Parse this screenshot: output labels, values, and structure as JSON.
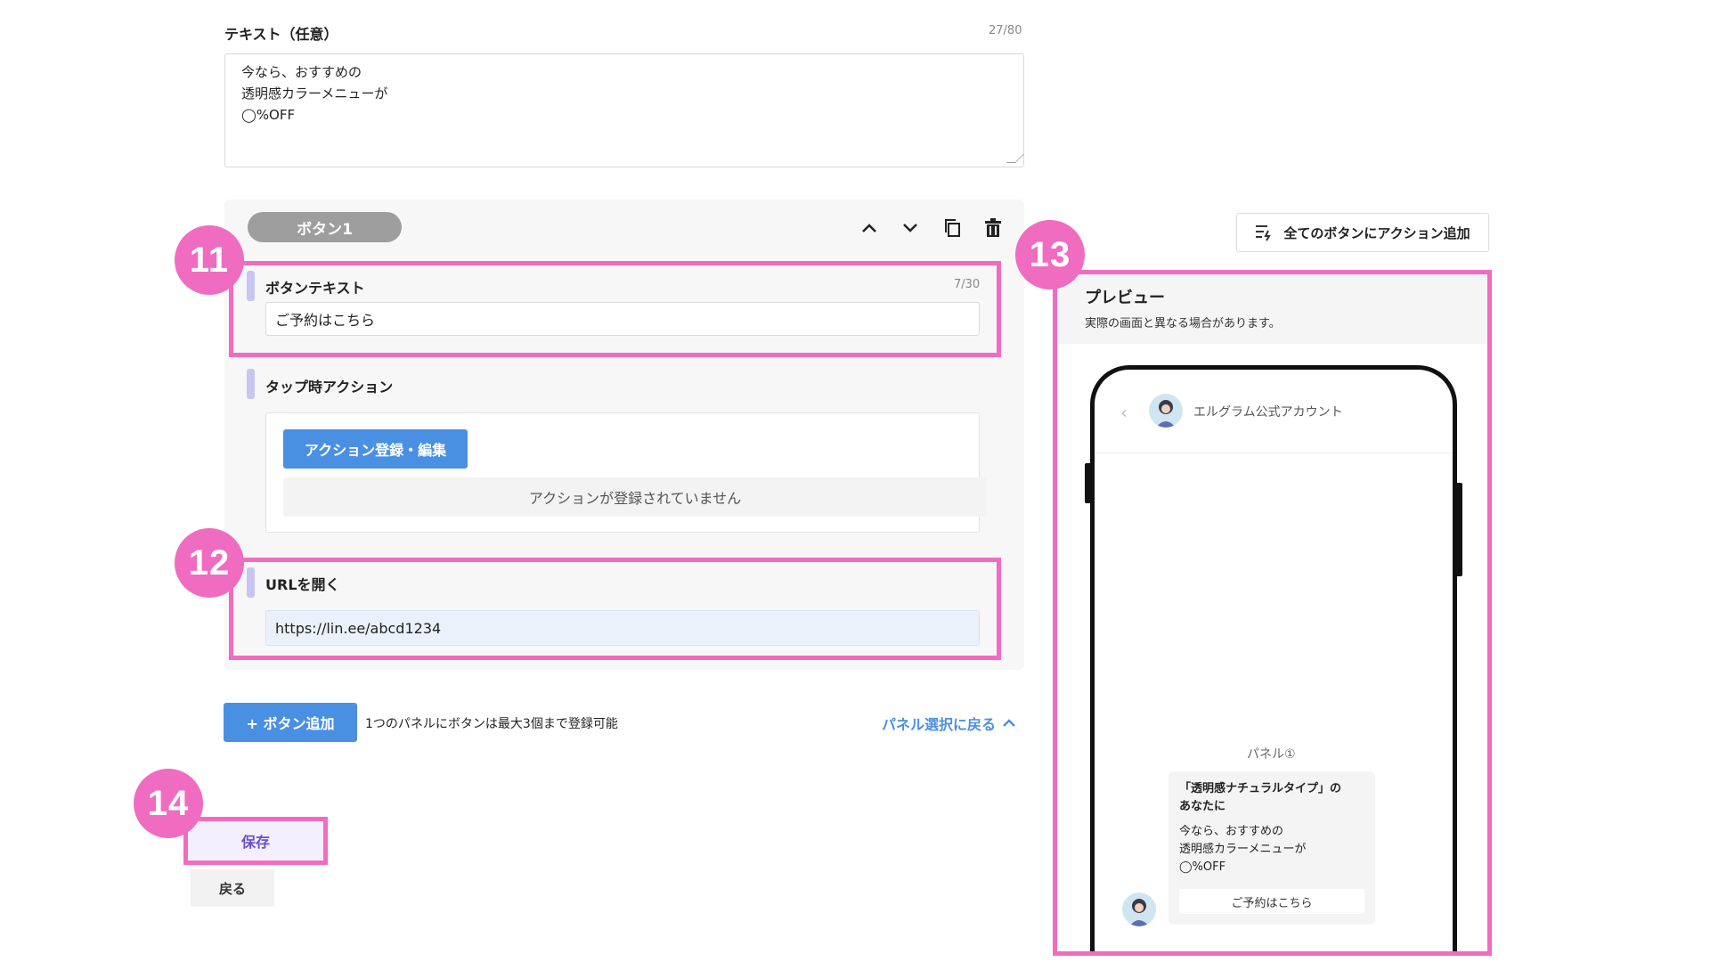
{
  "text_field": {
    "label": "テキスト（任意）",
    "counter": "27/80",
    "lines": [
      "今なら、おすすめの",
      "透明感カラーメニューが",
      "◯%OFF"
    ]
  },
  "button_panel": {
    "name": "ボタン1",
    "icons": {
      "up": "chevron-up-icon",
      "down": "chevron-down-icon",
      "copy": "copy-icon",
      "delete": "trash-icon"
    },
    "button_text": {
      "label": "ボタンテキスト",
      "counter": "7/30",
      "value": "ご予約はこちら"
    },
    "tap_action": {
      "label": "タップ時アクション",
      "register_button": "アクション登録・編集",
      "empty_message": "アクションが登録されていません"
    },
    "open_url": {
      "label": "URLを開く",
      "value": "https://lin.ee/abcd1234"
    }
  },
  "footer": {
    "add_button": "+ ボタン追加",
    "note": "1つのパネルにボタンは最大3個まで登録可能",
    "back_to_panel": "パネル選択に戻る",
    "save": "保存",
    "back": "戻る"
  },
  "right": {
    "add_all_actions": "全てのボタンにアクション追加",
    "preview_title": "プレビュー",
    "preview_subtitle": "実際の画面と異なる場合があります。",
    "chat": {
      "account_name": "エルグラム公式アカウント",
      "panel_label": "パネル①",
      "card_title": "「透明感ナチュラルタイプ」の\nあなたに",
      "card_lines": [
        "今なら、おすすめの",
        "透明感カラーメニューが",
        "◯%OFF"
      ],
      "card_button": "ご予約はこちら"
    }
  },
  "markers": [
    "11",
    "12",
    "13",
    "14"
  ],
  "colors": {
    "highlight": "#f06cc0",
    "primary": "#4a90e2",
    "accent_bar": "#c9c5f3",
    "save_text": "#6a4ec7"
  }
}
